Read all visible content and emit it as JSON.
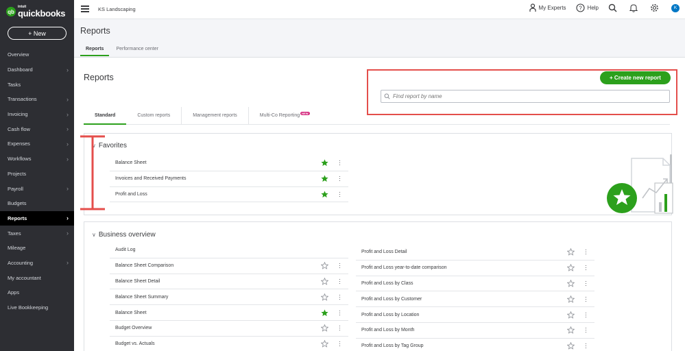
{
  "brand": {
    "intuit": "intuit",
    "name": "quickbooks",
    "logo_color": "#2ca01c"
  },
  "sidebar": {
    "new_label": "+ New",
    "items": [
      {
        "label": "Overview",
        "chevron": false
      },
      {
        "label": "Dashboard",
        "chevron": true
      },
      {
        "label": "Tasks",
        "chevron": false
      },
      {
        "label": "Transactions",
        "chevron": true
      },
      {
        "label": "Invoicing",
        "chevron": true
      },
      {
        "label": "Cash flow",
        "chevron": true
      },
      {
        "label": "Expenses",
        "chevron": true
      },
      {
        "label": "Workflows",
        "chevron": true
      },
      {
        "label": "Projects",
        "chevron": false
      },
      {
        "label": "Payroll",
        "chevron": true
      },
      {
        "label": "Budgets",
        "chevron": false
      },
      {
        "label": "Reports",
        "chevron": true,
        "active": true
      },
      {
        "label": "Taxes",
        "chevron": true
      },
      {
        "label": "Mileage",
        "chevron": false
      },
      {
        "label": "Accounting",
        "chevron": true
      },
      {
        "label": "My accountant",
        "chevron": false
      },
      {
        "label": "Apps",
        "chevron": false
      },
      {
        "label": "Live Bookkeeping",
        "chevron": false
      }
    ]
  },
  "topbar": {
    "company": "KS Landscaping",
    "my_experts": "My Experts",
    "help": "Help",
    "avatar_initial": "K"
  },
  "page": {
    "title": "Reports",
    "tabs": [
      {
        "label": "Reports",
        "active": true
      },
      {
        "label": "Performance center",
        "active": false
      }
    ]
  },
  "content": {
    "heading": "Reports",
    "create_button": "+ Create new report",
    "search_placeholder": "Find report by name",
    "sub_tabs": [
      {
        "label": "Standard",
        "active": true
      },
      {
        "label": "Custom reports"
      },
      {
        "label": "Management reports"
      },
      {
        "label": "Multi-Co Reporting",
        "badge": "NEW"
      }
    ]
  },
  "favorites": {
    "title": "Favorites",
    "items": [
      {
        "label": "Balance Sheet",
        "starred": true
      },
      {
        "label": "Invoices and Received Payments",
        "starred": true
      },
      {
        "label": "Profit and Loss",
        "starred": true
      }
    ]
  },
  "business_overview": {
    "title": "Business overview",
    "left": [
      {
        "label": "Audit Log",
        "starred": null
      },
      {
        "label": "Balance Sheet Comparison",
        "starred": false
      },
      {
        "label": "Balance Sheet Detail",
        "starred": false
      },
      {
        "label": "Balance Sheet Summary",
        "starred": false
      },
      {
        "label": "Balance Sheet",
        "starred": true
      },
      {
        "label": "Budget Overview",
        "starred": false
      },
      {
        "label": "Budget vs. Actuals",
        "starred": false
      }
    ],
    "right": [
      {
        "label": "Profit and Loss Detail",
        "starred": false
      },
      {
        "label": "Profit and Loss year-to-date comparison",
        "starred": false
      },
      {
        "label": "Profit and Loss by Class",
        "starred": false
      },
      {
        "label": "Profit and Loss by Customer",
        "starred": false
      },
      {
        "label": "Profit and Loss by Location",
        "starred": false
      },
      {
        "label": "Profit and Loss by Month",
        "starred": false
      },
      {
        "label": "Profit and Loss by Tag Group",
        "starred": false
      }
    ]
  },
  "colors": {
    "accent": "#2ca01c",
    "annotation": "#e44e4b",
    "sidebar": "#2d2e33"
  }
}
